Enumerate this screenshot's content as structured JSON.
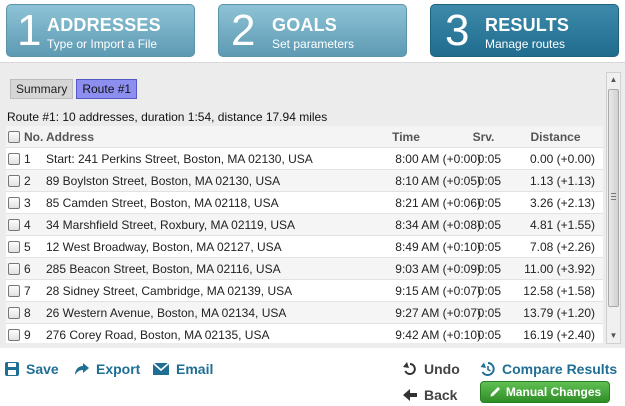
{
  "steps": [
    {
      "num": "1",
      "title": "ADDRESSES",
      "sub": "Type or Import a File"
    },
    {
      "num": "2",
      "title": "GOALS",
      "sub": "Set parameters"
    },
    {
      "num": "3",
      "title": "RESULTS",
      "sub": "Manage routes"
    }
  ],
  "subtabs": {
    "summary": "Summary",
    "route1": "Route #1"
  },
  "summary_text": "Route #1: 10 addresses, duration 1:54, distance 17.94 miles",
  "table": {
    "headers": {
      "no": "No.",
      "address": "Address",
      "time": "Time",
      "srv": "Srv.",
      "distance": "Distance"
    },
    "rows": [
      {
        "no": "1",
        "address": "Start: 241 Perkins Street, Boston, MA 02130, USA",
        "time": "8:00 AM (+0:00)",
        "srv": "0:05",
        "distance": "0.00 (+0.00)"
      },
      {
        "no": "2",
        "address": "89 Boylston Street, Boston, MA 02130, USA",
        "time": "8:10 AM (+0:05)",
        "srv": "0:05",
        "distance": "1.13 (+1.13)"
      },
      {
        "no": "3",
        "address": "85 Camden Street, Boston, MA 02118, USA",
        "time": "8:21 AM (+0:06)",
        "srv": "0:05",
        "distance": "3.26 (+2.13)"
      },
      {
        "no": "4",
        "address": "34 Marshfield Street, Roxbury, MA 02119, USA",
        "time": "8:34 AM (+0:08)",
        "srv": "0:05",
        "distance": "4.81 (+1.55)"
      },
      {
        "no": "5",
        "address": "12 West Broadway, Boston, MA 02127, USA",
        "time": "8:49 AM (+0:10)",
        "srv": "0:05",
        "distance": "7.08 (+2.26)"
      },
      {
        "no": "6",
        "address": "285 Beacon Street, Boston, MA 02116, USA",
        "time": "9:03 AM (+0:09)",
        "srv": "0:05",
        "distance": "11.00 (+3.92)"
      },
      {
        "no": "7",
        "address": "28 Sidney Street, Cambridge, MA 02139, USA",
        "time": "9:15 AM (+0:07)",
        "srv": "0:05",
        "distance": "12.58 (+1.58)"
      },
      {
        "no": "8",
        "address": "26 Western Avenue, Boston, MA 02134, USA",
        "time": "9:27 AM (+0:07)",
        "srv": "0:05",
        "distance": "13.79 (+1.20)"
      },
      {
        "no": "9",
        "address": "276 Corey Road, Boston, MA 02135, USA",
        "time": "9:42 AM (+0:10)",
        "srv": "0:05",
        "distance": "16.19 (+2.40)"
      }
    ]
  },
  "toolbar": {
    "save": "Save",
    "export": "Export",
    "email": "Email",
    "undo": "Undo",
    "back": "Back",
    "compare": "Compare Results",
    "manual": "Manual Changes"
  },
  "colors": {
    "accent": "#1f6f94",
    "active_step": "#2a7a9c",
    "inactive_step": "#7db4c9",
    "active_subtab": "#8d8ff0",
    "manual_button": "#3f9f35"
  }
}
